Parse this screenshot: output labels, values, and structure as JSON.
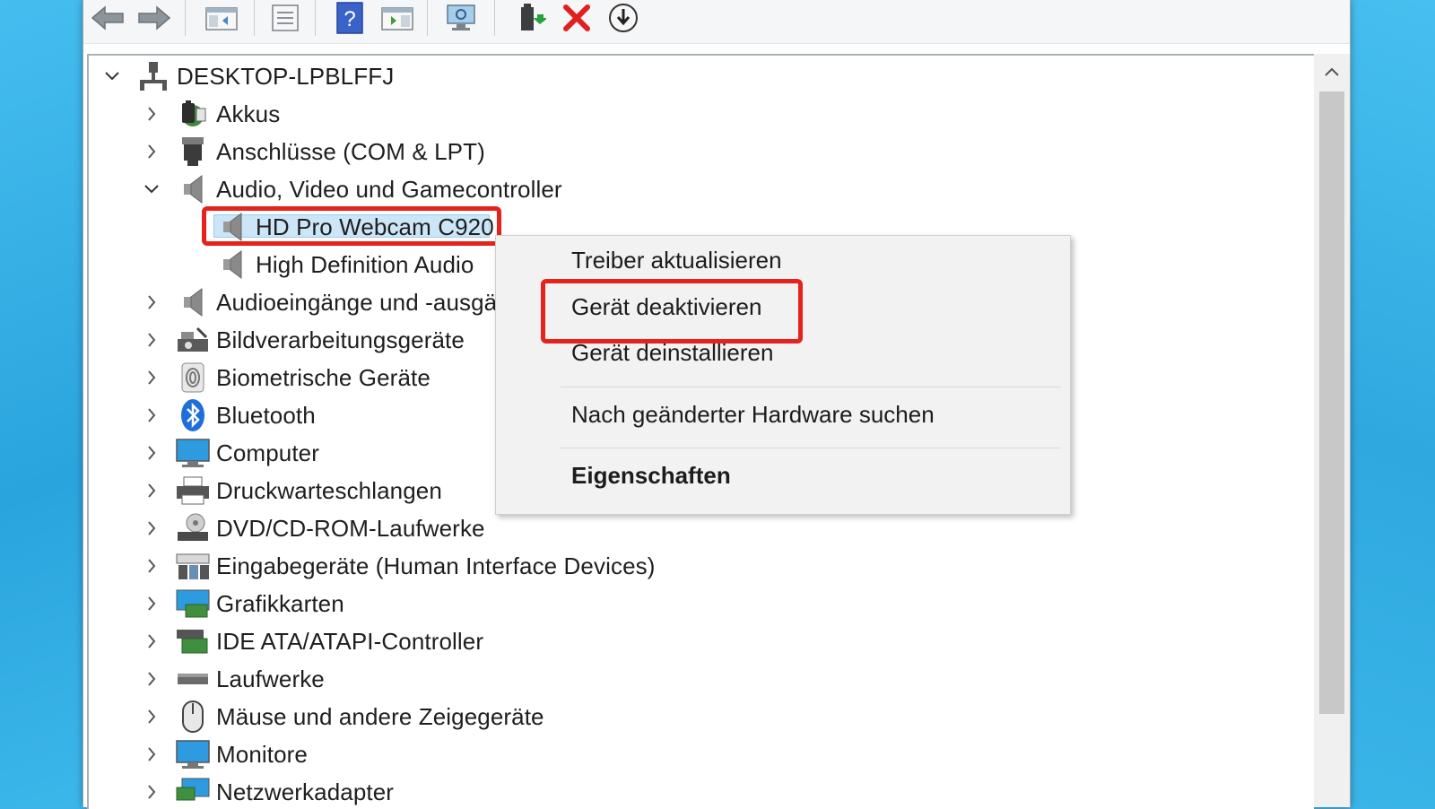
{
  "toolbar": {
    "buttons": [
      {
        "icon": "back-arrow-icon"
      },
      {
        "icon": "forward-arrow-icon"
      },
      {
        "icon": "show-hide-console-tree-icon"
      },
      {
        "icon": "properties-icon"
      },
      {
        "icon": "help-icon"
      },
      {
        "icon": "show-action-pane-icon"
      },
      {
        "icon": "scan-hardware-icon"
      },
      {
        "icon": "update-driver-icon"
      },
      {
        "icon": "uninstall-device-icon"
      },
      {
        "icon": "disable-device-icon"
      }
    ]
  },
  "tree": {
    "root": "DESKTOP-LPBLFFJ",
    "items": [
      {
        "label": "Akkus",
        "icon": "battery-icon",
        "expanded": false
      },
      {
        "label": "Anschlüsse (COM & LPT)",
        "icon": "port-icon",
        "expanded": false
      },
      {
        "label": "Audio, Video und Gamecontroller",
        "icon": "speaker-icon",
        "expanded": true
      },
      {
        "label": "HD Pro Webcam C920",
        "icon": "speaker-icon",
        "child": true,
        "selected": true
      },
      {
        "label": "High Definition Audio",
        "icon": "speaker-icon",
        "child": true
      },
      {
        "label": "Audioeingänge und -ausgänge",
        "icon": "speaker-icon",
        "expanded": false
      },
      {
        "label": "Bildverarbeitungsgeräte",
        "icon": "camera-icon",
        "expanded": false
      },
      {
        "label": "Biometrische Geräte",
        "icon": "fingerprint-icon",
        "expanded": false
      },
      {
        "label": "Bluetooth",
        "icon": "bluetooth-icon",
        "expanded": false
      },
      {
        "label": "Computer",
        "icon": "monitor-icon",
        "expanded": false
      },
      {
        "label": "Druckwarteschlangen",
        "icon": "printer-icon",
        "expanded": false
      },
      {
        "label": "DVD/CD-ROM-Laufwerke",
        "icon": "disc-drive-icon",
        "expanded": false
      },
      {
        "label": "Eingabegeräte (Human Interface Devices)",
        "icon": "hid-icon",
        "expanded": false
      },
      {
        "label": "Grafikkarten",
        "icon": "display-adapter-icon",
        "expanded": false
      },
      {
        "label": "IDE ATA/ATAPI-Controller",
        "icon": "controller-icon",
        "expanded": false
      },
      {
        "label": "Laufwerke",
        "icon": "drive-icon",
        "expanded": false
      },
      {
        "label": "Mäuse und andere Zeigegeräte",
        "icon": "mouse-icon",
        "expanded": false
      },
      {
        "label": "Monitore",
        "icon": "monitor-icon",
        "expanded": false
      },
      {
        "label": "Netzwerkadapter",
        "icon": "network-icon",
        "expanded": false
      }
    ]
  },
  "context_menu": {
    "items": [
      {
        "label": "Treiber aktualisieren"
      },
      {
        "label": "Gerät deaktivieren",
        "highlighted": true
      },
      {
        "label": "Gerät deinstallieren"
      },
      {
        "label": "Nach geänderter Hardware suchen"
      },
      {
        "label": "Eigenschaften",
        "bold": true
      }
    ]
  },
  "colors": {
    "highlight_box": "#e5221b",
    "selection": "#cce6f8",
    "desktop": "#3fb3e8"
  }
}
